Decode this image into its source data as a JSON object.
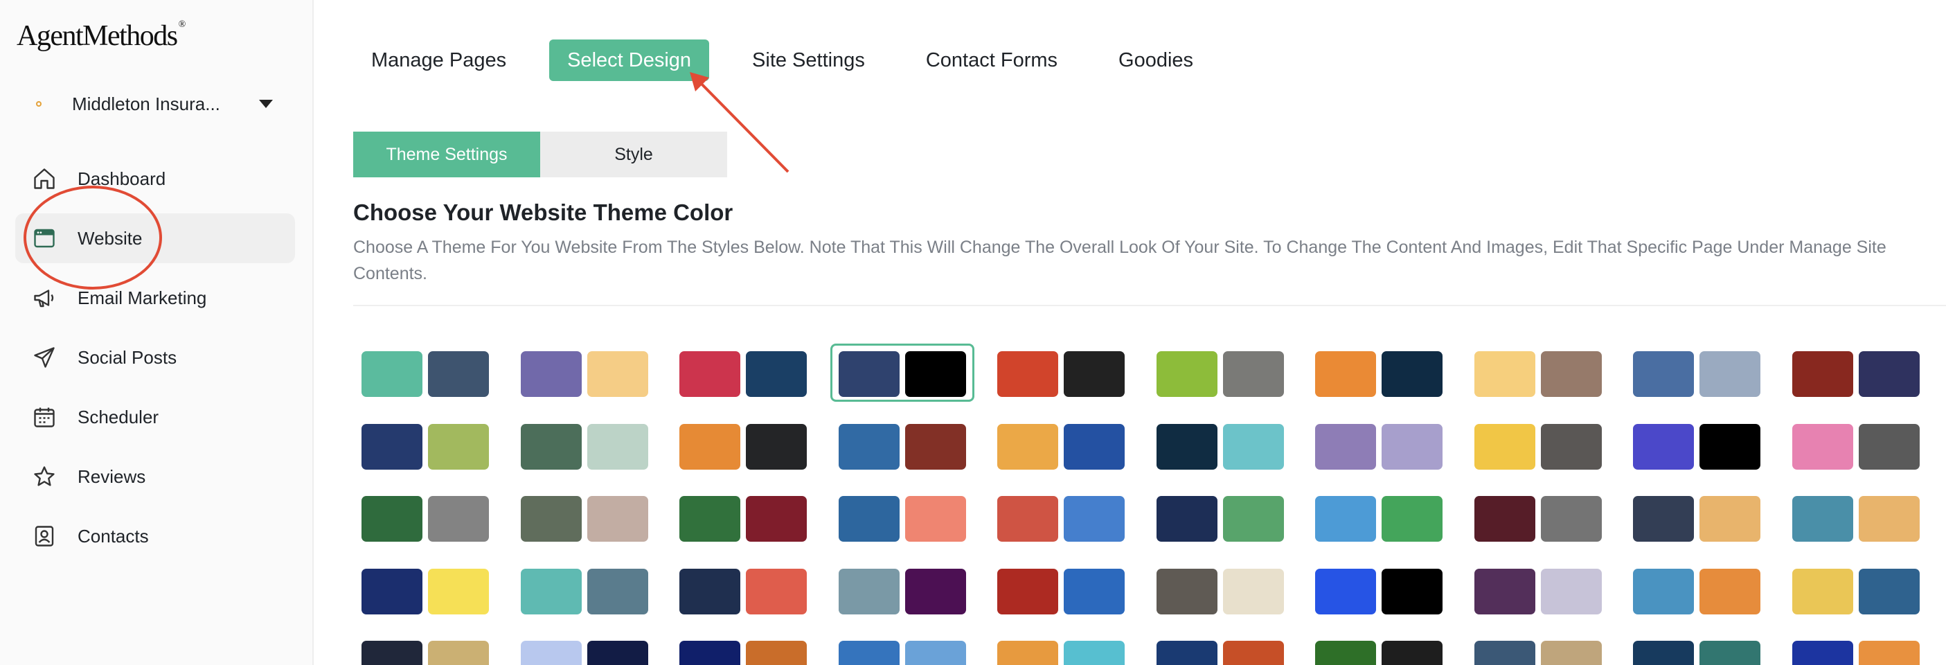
{
  "brand": {
    "logo_text": "AgentMethods",
    "logo_mark": "®"
  },
  "account": {
    "name": "Middleton Insura..."
  },
  "sidebar": {
    "items": [
      {
        "label": "Dashboard",
        "icon": "home-icon"
      },
      {
        "label": "Website",
        "icon": "browser-window-icon"
      },
      {
        "label": "Email Marketing",
        "icon": "megaphone-icon"
      },
      {
        "label": "Social Posts",
        "icon": "paper-plane-icon"
      },
      {
        "label": "Scheduler",
        "icon": "calendar-icon"
      },
      {
        "label": "Reviews",
        "icon": "star-icon"
      },
      {
        "label": "Contacts",
        "icon": "contact-card-icon"
      }
    ],
    "active_index": 1
  },
  "top_tabs": {
    "items": [
      "Manage Pages",
      "Select Design",
      "Site Settings",
      "Contact Forms",
      "Goodies"
    ],
    "active_index": 1
  },
  "sub_tabs": {
    "items": [
      "Theme Settings",
      "Style"
    ],
    "active_index": 0
  },
  "section": {
    "title": "Choose Your Website Theme Color",
    "description": "Choose A Theme For You Website From The Styles Below. Note That This Will Change The Overall Look Of Your Site. To Change The Content And Images, Edit That Specific Page Under Manage Site Contents."
  },
  "colors": {
    "accent": "#58bb94",
    "annotation": "#e14b35"
  },
  "themes": {
    "selected_row": 0,
    "selected_col": 3,
    "rows": [
      [
        [
          "#5bbb9e",
          "#3e546f"
        ],
        [
          "#7169aa",
          "#f5cd86"
        ],
        [
          "#cc344d",
          "#1a3f65"
        ],
        [
          "#2f426e",
          "#000000"
        ],
        [
          "#d1442b",
          "#222222"
        ],
        [
          "#8dbc3a",
          "#7a7a77"
        ],
        [
          "#ea8a35",
          "#0f2b44"
        ],
        [
          "#f6cf7d",
          "#967a6a"
        ],
        [
          "#4a6ea2",
          "#9aaac0"
        ],
        [
          "#88281f",
          "#2f325f"
        ]
      ],
      [
        [
          "#253a6e",
          "#a2b95e"
        ],
        [
          "#4c6e5a",
          "#bcd3c7"
        ],
        [
          "#e68a35",
          "#242527"
        ],
        [
          "#316aa4",
          "#823026"
        ],
        [
          "#eba847",
          "#2451a2"
        ],
        [
          "#102c42",
          "#6cc3c9"
        ],
        [
          "#8e7db6",
          "#a79fcc"
        ],
        [
          "#f1c646",
          "#5a5755"
        ],
        [
          "#4b48c9",
          "#000000"
        ],
        [
          "#e782b1",
          "#5a5a5a"
        ]
      ],
      [
        [
          "#2f6b3d",
          "#838383"
        ],
        [
          "#606d5c",
          "#c2ada3"
        ],
        [
          "#31713c",
          "#7f1d2b"
        ],
        [
          "#2d669e",
          "#ef8571"
        ],
        [
          "#cf5444",
          "#457fcd"
        ],
        [
          "#1d2e56",
          "#58a46b"
        ],
        [
          "#4d9bd6",
          "#44a55b"
        ],
        [
          "#561d28",
          "#747474"
        ],
        [
          "#333e55",
          "#e8b46c"
        ],
        [
          "#4a8fa8",
          "#e8b46c"
        ]
      ],
      [
        [
          "#1b2e6e",
          "#f6e056"
        ],
        [
          "#5fbab2",
          "#5a7c8d"
        ],
        [
          "#1f2f4f",
          "#df5d4c"
        ],
        [
          "#7a99a6",
          "#4c1053"
        ],
        [
          "#ad2a22",
          "#2c69bd"
        ],
        [
          "#5f5a54",
          "#e8e0cc"
        ],
        [
          "#2654e5",
          "#000000"
        ],
        [
          "#532f5a",
          "#c7c3d8"
        ],
        [
          "#4a93c1",
          "#e68c3c"
        ],
        [
          "#eac656",
          "#2f628e"
        ]
      ],
      [
        [
          "#20273a",
          "#cbb073"
        ],
        [
          "#b8c8ee",
          "#121c45"
        ],
        [
          "#101f6a",
          "#c96d2a"
        ],
        [
          "#3574bd",
          "#6aa2d8"
        ],
        [
          "#e79a3f",
          "#57bfd0"
        ],
        [
          "#1a3a72",
          "#c64f27"
        ],
        [
          "#2e6f28",
          "#1e1e1e"
        ],
        [
          "#3b5876",
          "#bfa57c"
        ],
        [
          "#173a5e",
          "#327670"
        ],
        [
          "#1c34a0",
          "#e8913f"
        ]
      ]
    ]
  }
}
